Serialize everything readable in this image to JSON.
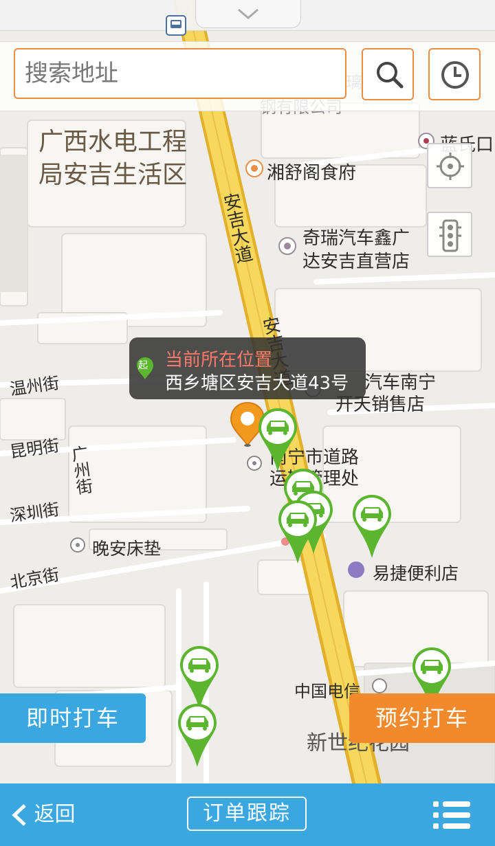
{
  "colors": {
    "accent_orange": "#ec8d45",
    "primary_blue": "#3aa7e1",
    "car_green": "#5bb52f",
    "road_yellow": "#f8d85c",
    "road_border": "#e3b02c",
    "map_bg": "#efede9"
  },
  "search": {
    "placeholder": "搜索地址"
  },
  "map": {
    "labels": {
      "area_line1": "广西水电工程",
      "area_line2": "局安吉生活区",
      "company_cut": "钢有限公司",
      "cut_char": "璃",
      "restaurant": "湘舒阁食府",
      "blue_clinic": "蓝氏口",
      "chery_line1": "奇瑞汽车鑫广",
      "chery_line2": "达安吉直营店",
      "road_main": "安吉大道",
      "road_main_2": "安吉大道",
      "car_sales_line1": "汽车南宁",
      "car_sales_line2": "开天销售店",
      "transport_line1": "南宁市道路",
      "transport_line2": "运输管理处",
      "wenzhou": "温州街",
      "kunming": "昆明街",
      "guangzhou": "广州街",
      "shenzhen": "深圳街",
      "beijing": "北京街",
      "mattress": "晚安床垫",
      "store": "易捷便利店",
      "telecom": "中国电信",
      "garden": "新世纪花园"
    }
  },
  "popup": {
    "start_badge": "起",
    "title": "当前所在位置",
    "address": "西乡塘区安吉大道43号"
  },
  "buttons": {
    "instant": "即时打车",
    "reserve": "预约打车"
  },
  "bottom": {
    "back": "返回",
    "track": "订单跟踪"
  },
  "icons": {
    "search": "search-icon",
    "history": "clock-icon",
    "locate": "locate-icon",
    "traffic": "traffic-light-icon",
    "menu": "menu-icon",
    "back": "chevron-left-icon",
    "car": "car-icon"
  }
}
